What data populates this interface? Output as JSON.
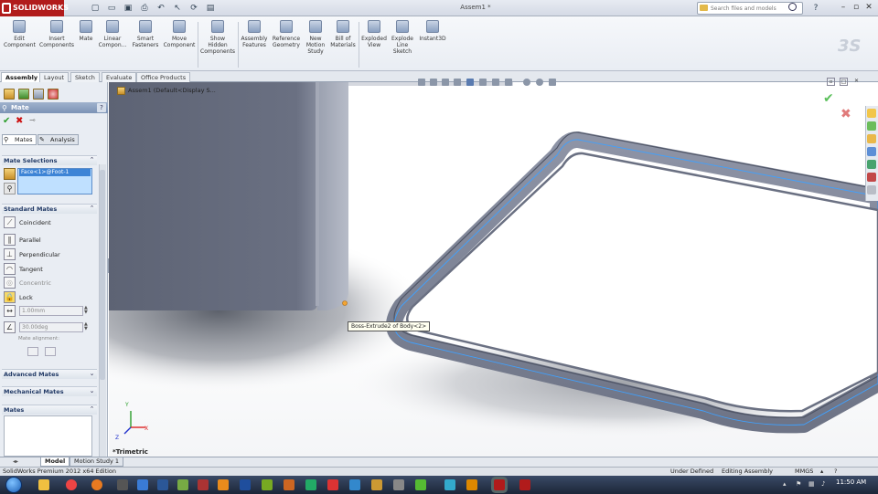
{
  "app": {
    "logo_text": "SOLIDWORKS",
    "document_title": "Assem1 *",
    "search_placeholder": "Search files and models"
  },
  "command_manager": {
    "items": [
      {
        "label": "Edit\nComponent"
      },
      {
        "label": "Insert\nComponents"
      },
      {
        "label": "Mate"
      },
      {
        "label": "Linear\nCompon..."
      },
      {
        "label": "Smart\nFasteners"
      },
      {
        "label": "Move\nComponent"
      },
      {
        "label": "Show\nHidden\nComponents"
      },
      {
        "label": "Assembly\nFeatures"
      },
      {
        "label": "Reference\nGeometry"
      },
      {
        "label": "New\nMotion\nStudy"
      },
      {
        "label": "Bill of\nMaterials"
      },
      {
        "label": "Exploded\nView"
      },
      {
        "label": "Explode\nLine\nSketch"
      },
      {
        "label": "Instant3D"
      }
    ]
  },
  "tabs": [
    {
      "label": "Assembly",
      "active": true
    },
    {
      "label": "Layout"
    },
    {
      "label": "Sketch"
    },
    {
      "label": "Evaluate"
    },
    {
      "label": "Office Products"
    }
  ],
  "property_manager": {
    "title": "Mate",
    "help": "?",
    "subtabs": [
      {
        "label": "Mates"
      },
      {
        "label": "Analysis"
      }
    ],
    "mate_selections": {
      "header": "Mate Selections",
      "item": "Face<1>@Foot-1"
    },
    "standard_mates": {
      "header": "Standard Mates",
      "options": [
        {
          "label": "Coincident",
          "icon": "coincident-icon"
        },
        {
          "label": "Parallel",
          "icon": "parallel-icon"
        },
        {
          "label": "Perpendicular",
          "icon": "perpendicular-icon"
        },
        {
          "label": "Tangent",
          "icon": "tangent-icon"
        },
        {
          "label": "Concentric",
          "icon": "concentric-icon",
          "disabled": true
        },
        {
          "label": "Lock",
          "icon": "lock-icon"
        }
      ],
      "distance_value": "1.00mm",
      "angle_value": "30.00deg",
      "alignment_label": "Mate alignment:"
    },
    "advanced_mates": {
      "header": "Advanced Mates"
    },
    "mechanical_mates": {
      "header": "Mechanical Mates"
    },
    "mates": {
      "header": "Mates"
    }
  },
  "viewport": {
    "tree_root": "Assem1  (Default<Display S...",
    "tooltip": "Boss-Extrude2 of Body<2>",
    "view_orientation": "*Trimetric",
    "triad_labels": {
      "x": "X",
      "y": "Y",
      "z": "Z"
    }
  },
  "bottom_tabs": [
    {
      "label": "Model",
      "active": true
    },
    {
      "label": "Motion Study 1"
    }
  ],
  "status_bar": {
    "edition": "SolidWorks Premium 2012 x64 Edition",
    "definition": "Under Defined",
    "mode": "Editing Assembly",
    "units": "MMGS"
  },
  "taskbar": {
    "time": "11:50 AM"
  },
  "colors": {
    "brand_red": "#b11b1b",
    "selection_blue": "#3d84d6",
    "model_gray": "#7b8294",
    "accept_green": "#2a9d2a"
  }
}
